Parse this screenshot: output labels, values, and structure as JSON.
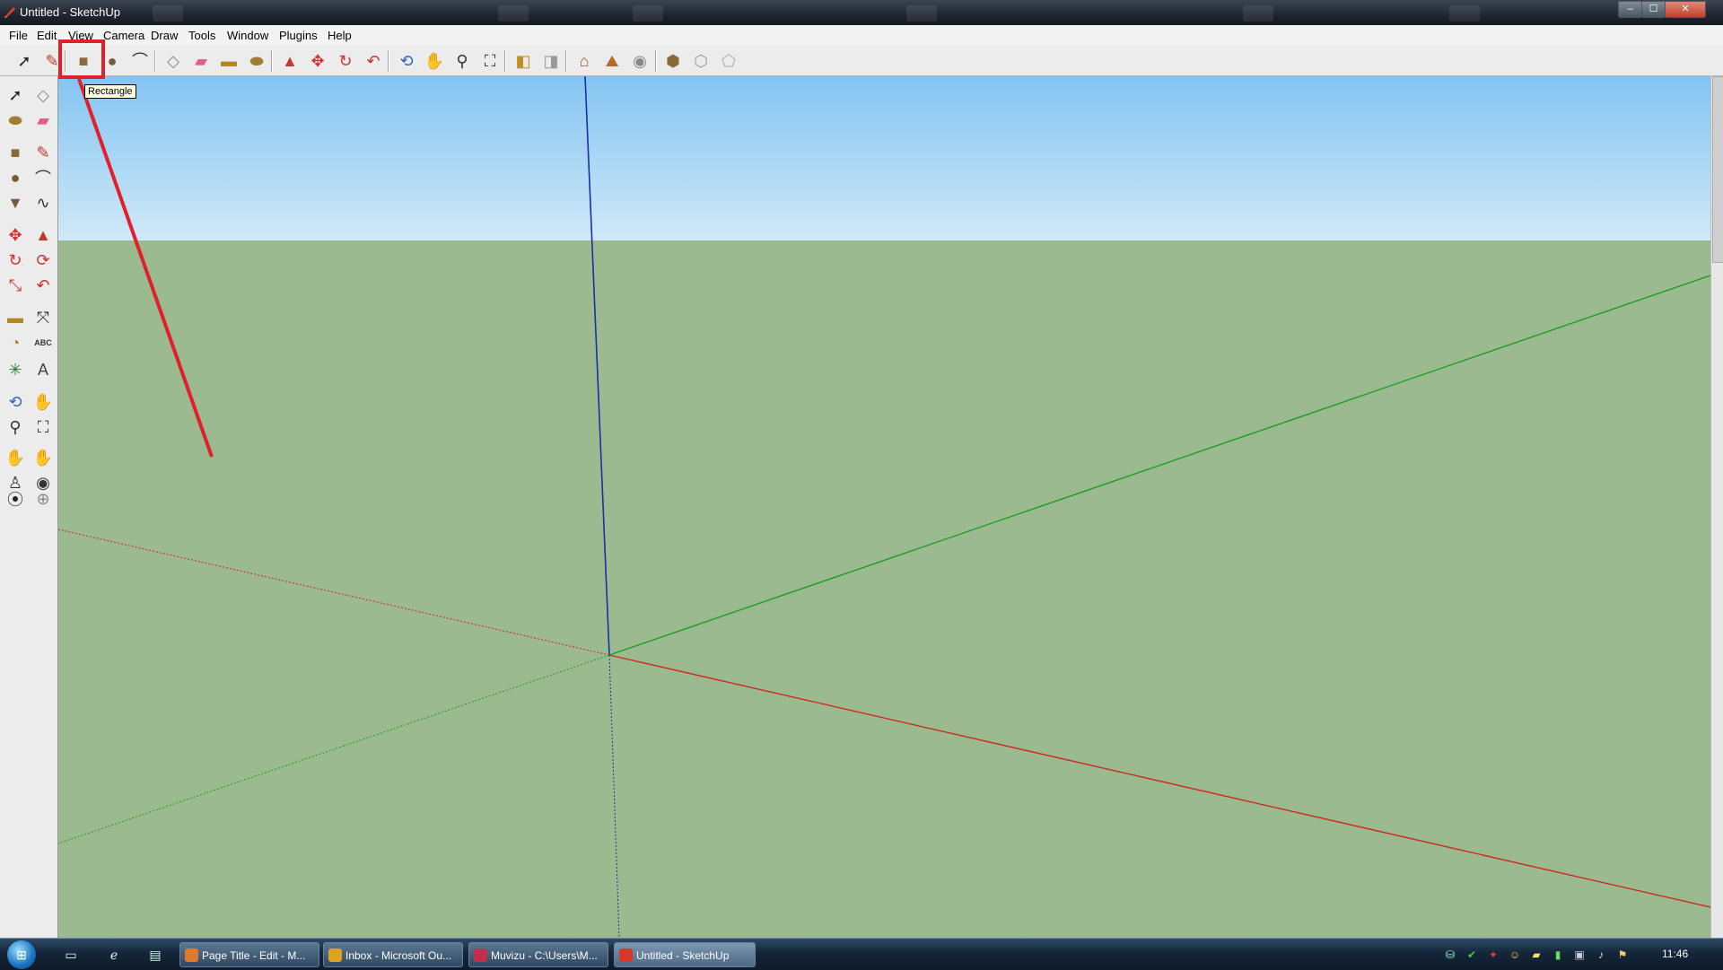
{
  "window": {
    "title": "Untitled - SketchUp"
  },
  "window_controls": {
    "minimize": "‒",
    "maximize": "☐",
    "close": "✕"
  },
  "menu": [
    {
      "label": "File"
    },
    {
      "label": "Edit"
    },
    {
      "label": "View"
    },
    {
      "label": "Camera"
    },
    {
      "label": "Draw"
    },
    {
      "label": "Tools"
    },
    {
      "label": "Window"
    },
    {
      "label": "Plugins"
    },
    {
      "label": "Help"
    }
  ],
  "tooltip": {
    "text": "Rectangle"
  },
  "toolbar": {
    "tools": [
      {
        "name": "select-tool",
        "glyph": "➚",
        "color": "#222222"
      },
      {
        "name": "line-tool",
        "glyph": "✎",
        "color": "#c0392b"
      },
      {
        "name": "rectangle-tool",
        "glyph": "■",
        "color": "#8a6a3a"
      },
      {
        "name": "circle-tool",
        "glyph": "●",
        "color": "#7a5a34"
      },
      {
        "name": "arc-tool",
        "glyph": "⌒",
        "color": "#333333"
      },
      {
        "name": "make-component-tool",
        "glyph": "◇",
        "color": "#888888"
      },
      {
        "name": "eraser-tool",
        "glyph": "▰",
        "color": "#e06080"
      },
      {
        "name": "tape-measure-tool",
        "glyph": "▬",
        "color": "#b08a20"
      },
      {
        "name": "paint-bucket-tool",
        "glyph": "⬬",
        "color": "#a07d30"
      },
      {
        "name": "push-pull-tool",
        "glyph": "▲",
        "color": "#c0392b"
      },
      {
        "name": "move-tool",
        "glyph": "✥",
        "color": "#d32f2f"
      },
      {
        "name": "rotate-tool",
        "glyph": "↻",
        "color": "#d32f2f"
      },
      {
        "name": "offset-tool",
        "glyph": "↶",
        "color": "#c0392b"
      },
      {
        "name": "orbit-tool",
        "glyph": "⟲",
        "color": "#2d67b8"
      },
      {
        "name": "pan-tool",
        "glyph": "✋",
        "color": "#555555"
      },
      {
        "name": "zoom-tool",
        "glyph": "⚲",
        "color": "#333333"
      },
      {
        "name": "zoom-extents-tool",
        "glyph": "⛶",
        "color": "#333333"
      },
      {
        "name": "previous-view-tool",
        "glyph": "◧",
        "color": "#c09020"
      },
      {
        "name": "next-view-tool",
        "glyph": "◨",
        "color": "#999999"
      },
      {
        "name": "add-location-tool",
        "glyph": "⌂",
        "color": "#8a5a30"
      },
      {
        "name": "toggle-terrain-tool",
        "glyph": "⛰",
        "color": "#b07020"
      },
      {
        "name": "photo-textures-tool",
        "glyph": "◉",
        "color": "#888888"
      },
      {
        "name": "get-models-tool",
        "glyph": "⬢",
        "color": "#8a6a3a"
      },
      {
        "name": "share-model-tool",
        "glyph": "⬡",
        "color": "#999999"
      },
      {
        "name": "share-component-tool",
        "glyph": "⬠",
        "color": "#aaaaaa"
      }
    ]
  },
  "palette": {
    "tools": [
      {
        "name": "select-tool",
        "glyph": "➚",
        "color": "#222222"
      },
      {
        "name": "make-component-tool",
        "glyph": "◇",
        "color": "#888888"
      },
      {
        "name": "paint-bucket-tool",
        "glyph": "⬬",
        "color": "#a07d30"
      },
      {
        "name": "eraser-tool",
        "glyph": "▰",
        "color": "#e06080"
      },
      {
        "name": "rectangle-tool",
        "glyph": "■",
        "color": "#8a6a3a"
      },
      {
        "name": "line-tool",
        "glyph": "✎",
        "color": "#c0392b"
      },
      {
        "name": "circle-tool",
        "glyph": "●",
        "color": "#7a5a34"
      },
      {
        "name": "arc-tool",
        "glyph": "⌒",
        "color": "#333333"
      },
      {
        "name": "polygon-tool",
        "glyph": "▼",
        "color": "#7a5a34"
      },
      {
        "name": "freehand-tool",
        "glyph": "∿",
        "color": "#333333"
      },
      {
        "name": "move-tool",
        "glyph": "✥",
        "color": "#d32f2f"
      },
      {
        "name": "push-pull-tool",
        "glyph": "▲",
        "color": "#c0392b"
      },
      {
        "name": "rotate-tool",
        "glyph": "↻",
        "color": "#d32f2f"
      },
      {
        "name": "follow-me-tool",
        "glyph": "⟳",
        "color": "#c0392b"
      },
      {
        "name": "scale-tool",
        "glyph": "⤡",
        "color": "#c0392b"
      },
      {
        "name": "offset-tool",
        "glyph": "↶",
        "color": "#c0392b"
      },
      {
        "name": "tape-measure-tool",
        "glyph": "▬",
        "color": "#b08a20"
      },
      {
        "name": "dimension-tool",
        "glyph": "⤧",
        "color": "#333333"
      },
      {
        "name": "protractor-tool",
        "glyph": "◔",
        "color": "#b08a20"
      },
      {
        "name": "text-tool",
        "glyph": "ABC",
        "color": "#333333"
      },
      {
        "name": "axes-tool",
        "glyph": "✳",
        "color": "#2e7d32"
      },
      {
        "name": "3d-text-tool",
        "glyph": "A",
        "color": "#444444"
      },
      {
        "name": "orbit-tool",
        "glyph": "⟲",
        "color": "#2d67b8"
      },
      {
        "name": "pan-tool",
        "glyph": "✋",
        "color": "#555555"
      },
      {
        "name": "zoom-tool",
        "glyph": "⚲",
        "color": "#333333"
      },
      {
        "name": "zoom-window-tool",
        "glyph": "⛶",
        "color": "#333333"
      },
      {
        "name": "previous-view-tool",
        "glyph": "✋",
        "color": "#aaaaaa"
      },
      {
        "name": "next-view-tool",
        "glyph": "✋",
        "color": "#aaaaaa"
      },
      {
        "name": "position-camera-tool",
        "glyph": "♙",
        "color": "#333333"
      },
      {
        "name": "look-around-tool",
        "glyph": "◉",
        "color": "#333333"
      },
      {
        "name": "walk-tool",
        "glyph": "⦿",
        "color": "#222222"
      },
      {
        "name": "section-plane-tool",
        "glyph": "⊕",
        "color": "#888888"
      }
    ]
  },
  "scene": {
    "sky_color": "#84c4f2",
    "ground_color": "#9cba8f",
    "axis_red": "#cc2a1f",
    "axis_green": "#1e9e1e",
    "axis_blue": "#1a2fa8"
  },
  "annotation": {
    "color": "#e0202a"
  },
  "taskbar": {
    "start_glyph": "⊞",
    "quicklaunch": [
      {
        "name": "show-desktop-icon",
        "glyph": "▭"
      },
      {
        "name": "internet-explorer-icon",
        "glyph": "ℯ"
      },
      {
        "name": "switch-windows-icon",
        "glyph": "▤"
      }
    ],
    "tasks": [
      {
        "label": "Page Title - Edit - M...",
        "color": "#e07a2a"
      },
      {
        "label": "Inbox - Microsoft Ou...",
        "color": "#e0a020"
      },
      {
        "label": "Muvizu - C:\\Users\\M...",
        "color": "#c0304a"
      },
      {
        "label": "Untitled - SketchUp",
        "color": "#d33a2a"
      }
    ],
    "tray": [
      {
        "name": "network-icon",
        "glyph": "⛁"
      },
      {
        "name": "security-check-icon",
        "glyph": "✔"
      },
      {
        "name": "adobe-icon",
        "glyph": "✦"
      },
      {
        "name": "messenger-icon",
        "glyph": "☺"
      },
      {
        "name": "update-icon",
        "glyph": "▰"
      },
      {
        "name": "battery-icon",
        "glyph": "▮"
      },
      {
        "name": "display-icon",
        "glyph": "▣"
      },
      {
        "name": "volume-icon",
        "glyph": "♪"
      },
      {
        "name": "flag-icon",
        "glyph": "⚑"
      }
    ],
    "clock": "11:46"
  }
}
